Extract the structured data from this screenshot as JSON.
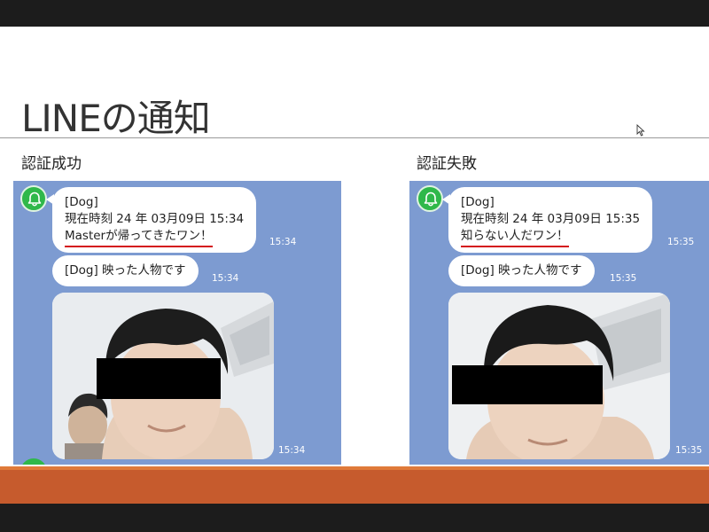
{
  "slide": {
    "title": "LINEの通知"
  },
  "panels": [
    {
      "label": "認証成功",
      "message": {
        "line1": "[Dog]",
        "line2": "現在時刻 24 年 03月09日 15:34",
        "line3": "Masterが帰ってきたワン！",
        "time": "15:34"
      },
      "photo_caption": {
        "text": "[Dog] 映った人物です",
        "time": "15:34"
      },
      "photo_time": "15:34"
    },
    {
      "label": "認証失敗",
      "message": {
        "line1": "[Dog]",
        "line2": "現在時刻 24 年 03月09日 15:35",
        "line3": "知らない人だワン！",
        "time": "15:35"
      },
      "photo_caption": {
        "text": "[Dog] 映った人物です",
        "time": "15:35"
      },
      "photo_time": "15:35"
    }
  ],
  "icons": {
    "avatar": "bell-icon",
    "pointer": "cursor-icon"
  },
  "colors": {
    "chat_background": "#7d9bd1",
    "avatar_green": "#2fb84a",
    "underline_red": "#d4151b",
    "footer_orange": "#c65b2d"
  }
}
